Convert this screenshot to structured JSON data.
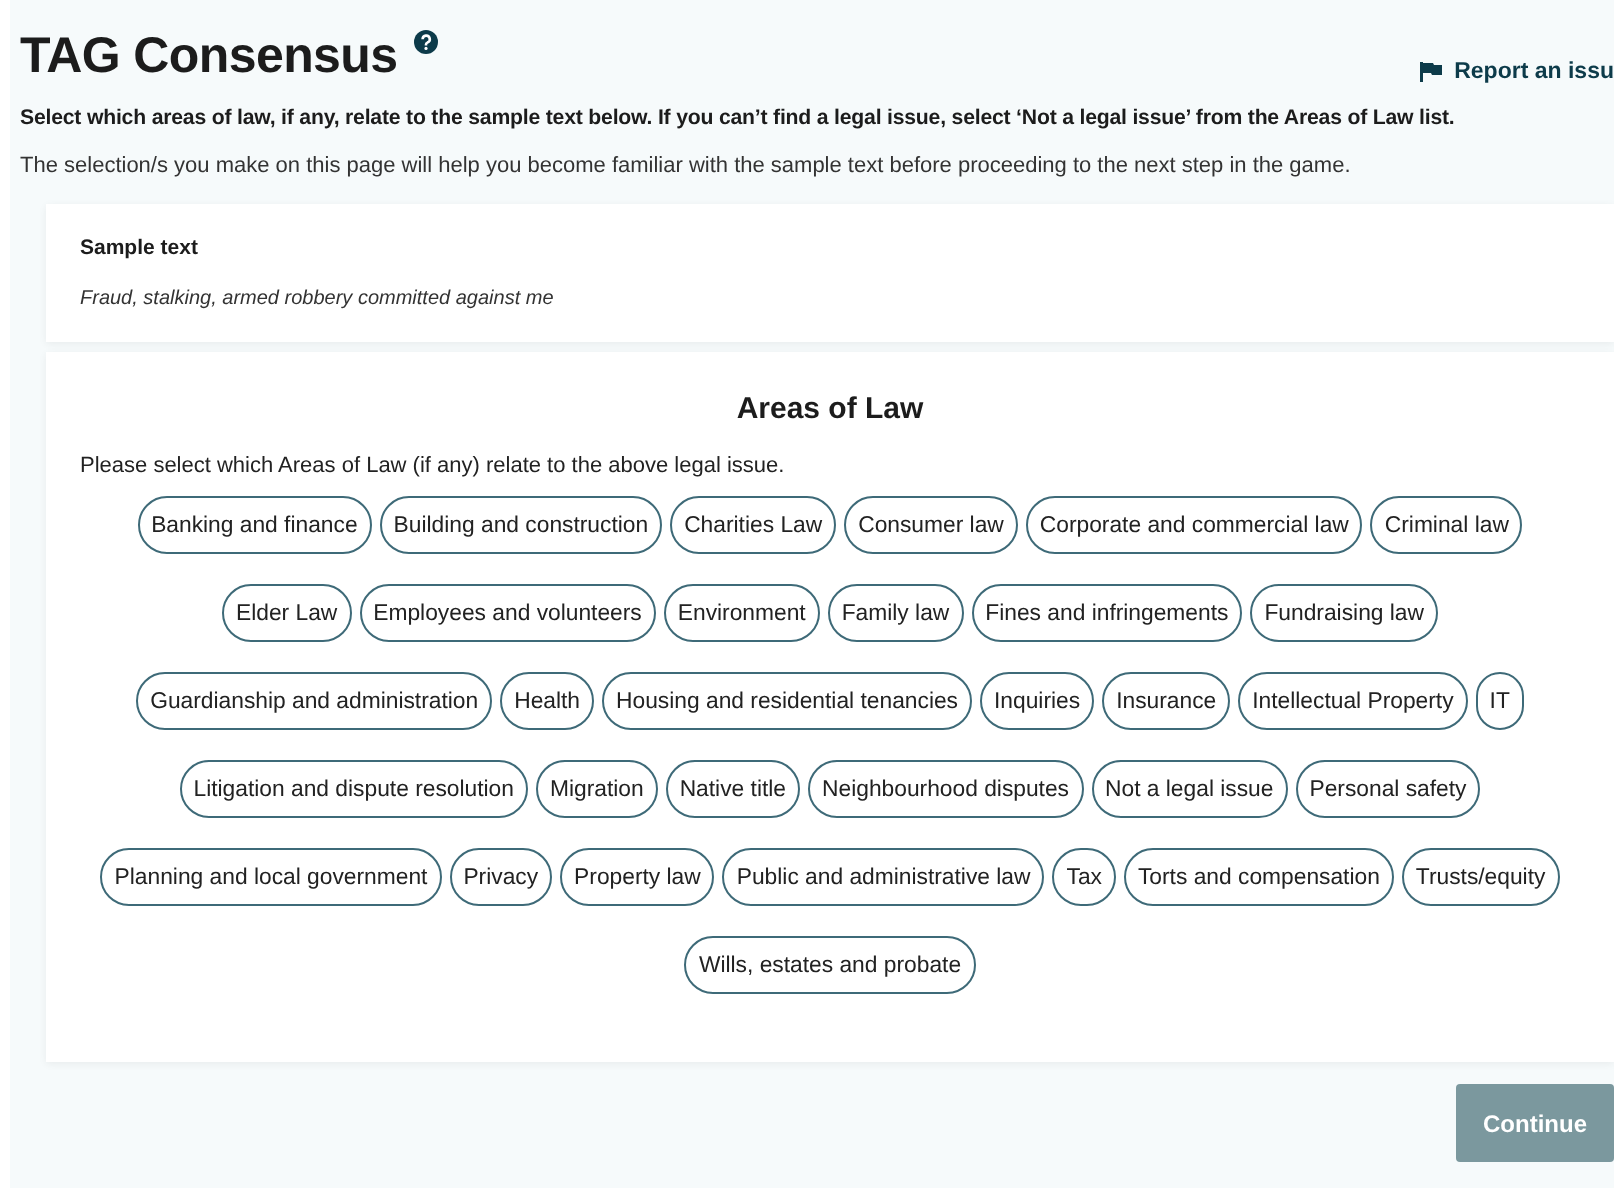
{
  "page": {
    "title": "TAG Consensus",
    "report_link": "Report an issu",
    "instruction": "Select which areas of law, if any, relate to the sample text below. If you can’t find a legal issue, select ‘Not a legal issue’ from the Areas of Law list.",
    "note": "The selection/s you make on this page will help you become familiar with the sample text before proceeding to the next step in the game."
  },
  "sample": {
    "heading": "Sample text",
    "text": "Fraud, stalking, armed robbery committed against me"
  },
  "areas": {
    "heading": "Areas of Law",
    "prompt": "Please select which Areas of Law (if any) relate to the above legal issue.",
    "chips": [
      {
        "label": "Banking and finance",
        "selected": false
      },
      {
        "label": "Building and construction",
        "selected": false
      },
      {
        "label": "Charities Law",
        "selected": false
      },
      {
        "label": "Consumer law",
        "selected": false
      },
      {
        "label": "Corporate and commercial law",
        "selected": false
      },
      {
        "label": "Criminal law",
        "selected": false
      },
      {
        "label": "Elder Law",
        "selected": false
      },
      {
        "label": "Employees and volunteers",
        "selected": false
      },
      {
        "label": "Environment",
        "selected": false
      },
      {
        "label": "Family law",
        "selected": false
      },
      {
        "label": "Fines and infringements",
        "selected": false
      },
      {
        "label": "Fundraising law",
        "selected": false
      },
      {
        "label": "Guardianship and administration",
        "selected": false
      },
      {
        "label": "Health",
        "selected": false
      },
      {
        "label": "Housing and residential tenancies",
        "selected": false
      },
      {
        "label": "Inquiries",
        "selected": false
      },
      {
        "label": "Insurance",
        "selected": false
      },
      {
        "label": "Intellectual Property",
        "selected": false
      },
      {
        "label": "IT",
        "selected": false
      },
      {
        "label": "Litigation and dispute resolution",
        "selected": false
      },
      {
        "label": "Migration",
        "selected": false
      },
      {
        "label": "Native title",
        "selected": false
      },
      {
        "label": "Neighbourhood disputes",
        "selected": false
      },
      {
        "label": "Not a legal issue",
        "selected": false
      },
      {
        "label": "Personal safety",
        "selected": false
      },
      {
        "label": "Planning and local government",
        "selected": false
      },
      {
        "label": "Privacy",
        "selected": false
      },
      {
        "label": "Property law",
        "selected": false
      },
      {
        "label": "Public and administrative law",
        "selected": false
      },
      {
        "label": "Tax",
        "selected": false
      },
      {
        "label": "Torts and compensation",
        "selected": false
      },
      {
        "label": "Trusts/equity",
        "selected": false
      },
      {
        "label": "Wills, estates and probate",
        "selected": false
      }
    ]
  },
  "continue_button": {
    "label": "Continue",
    "disabled": true
  }
}
